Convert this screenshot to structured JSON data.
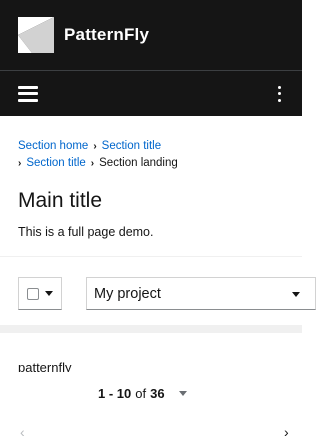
{
  "masthead": {
    "brand": "PatternFly"
  },
  "breadcrumb": {
    "items": [
      "Section home",
      "Section title",
      "Section title"
    ],
    "separator": "›",
    "current": "Section landing"
  },
  "page": {
    "title": "Main title",
    "description": "This is a full page demo."
  },
  "toolbar": {
    "project_select_value": "My project"
  },
  "list": {
    "first_item": "patternfly"
  },
  "pagination": {
    "range": "1 - 10",
    "of_label": "of",
    "total": "36",
    "prev_label": "‹",
    "next_label": "›"
  },
  "colors": {
    "masthead_bg": "#151515",
    "link": "#0066cc",
    "band": "#f0f0f0"
  }
}
